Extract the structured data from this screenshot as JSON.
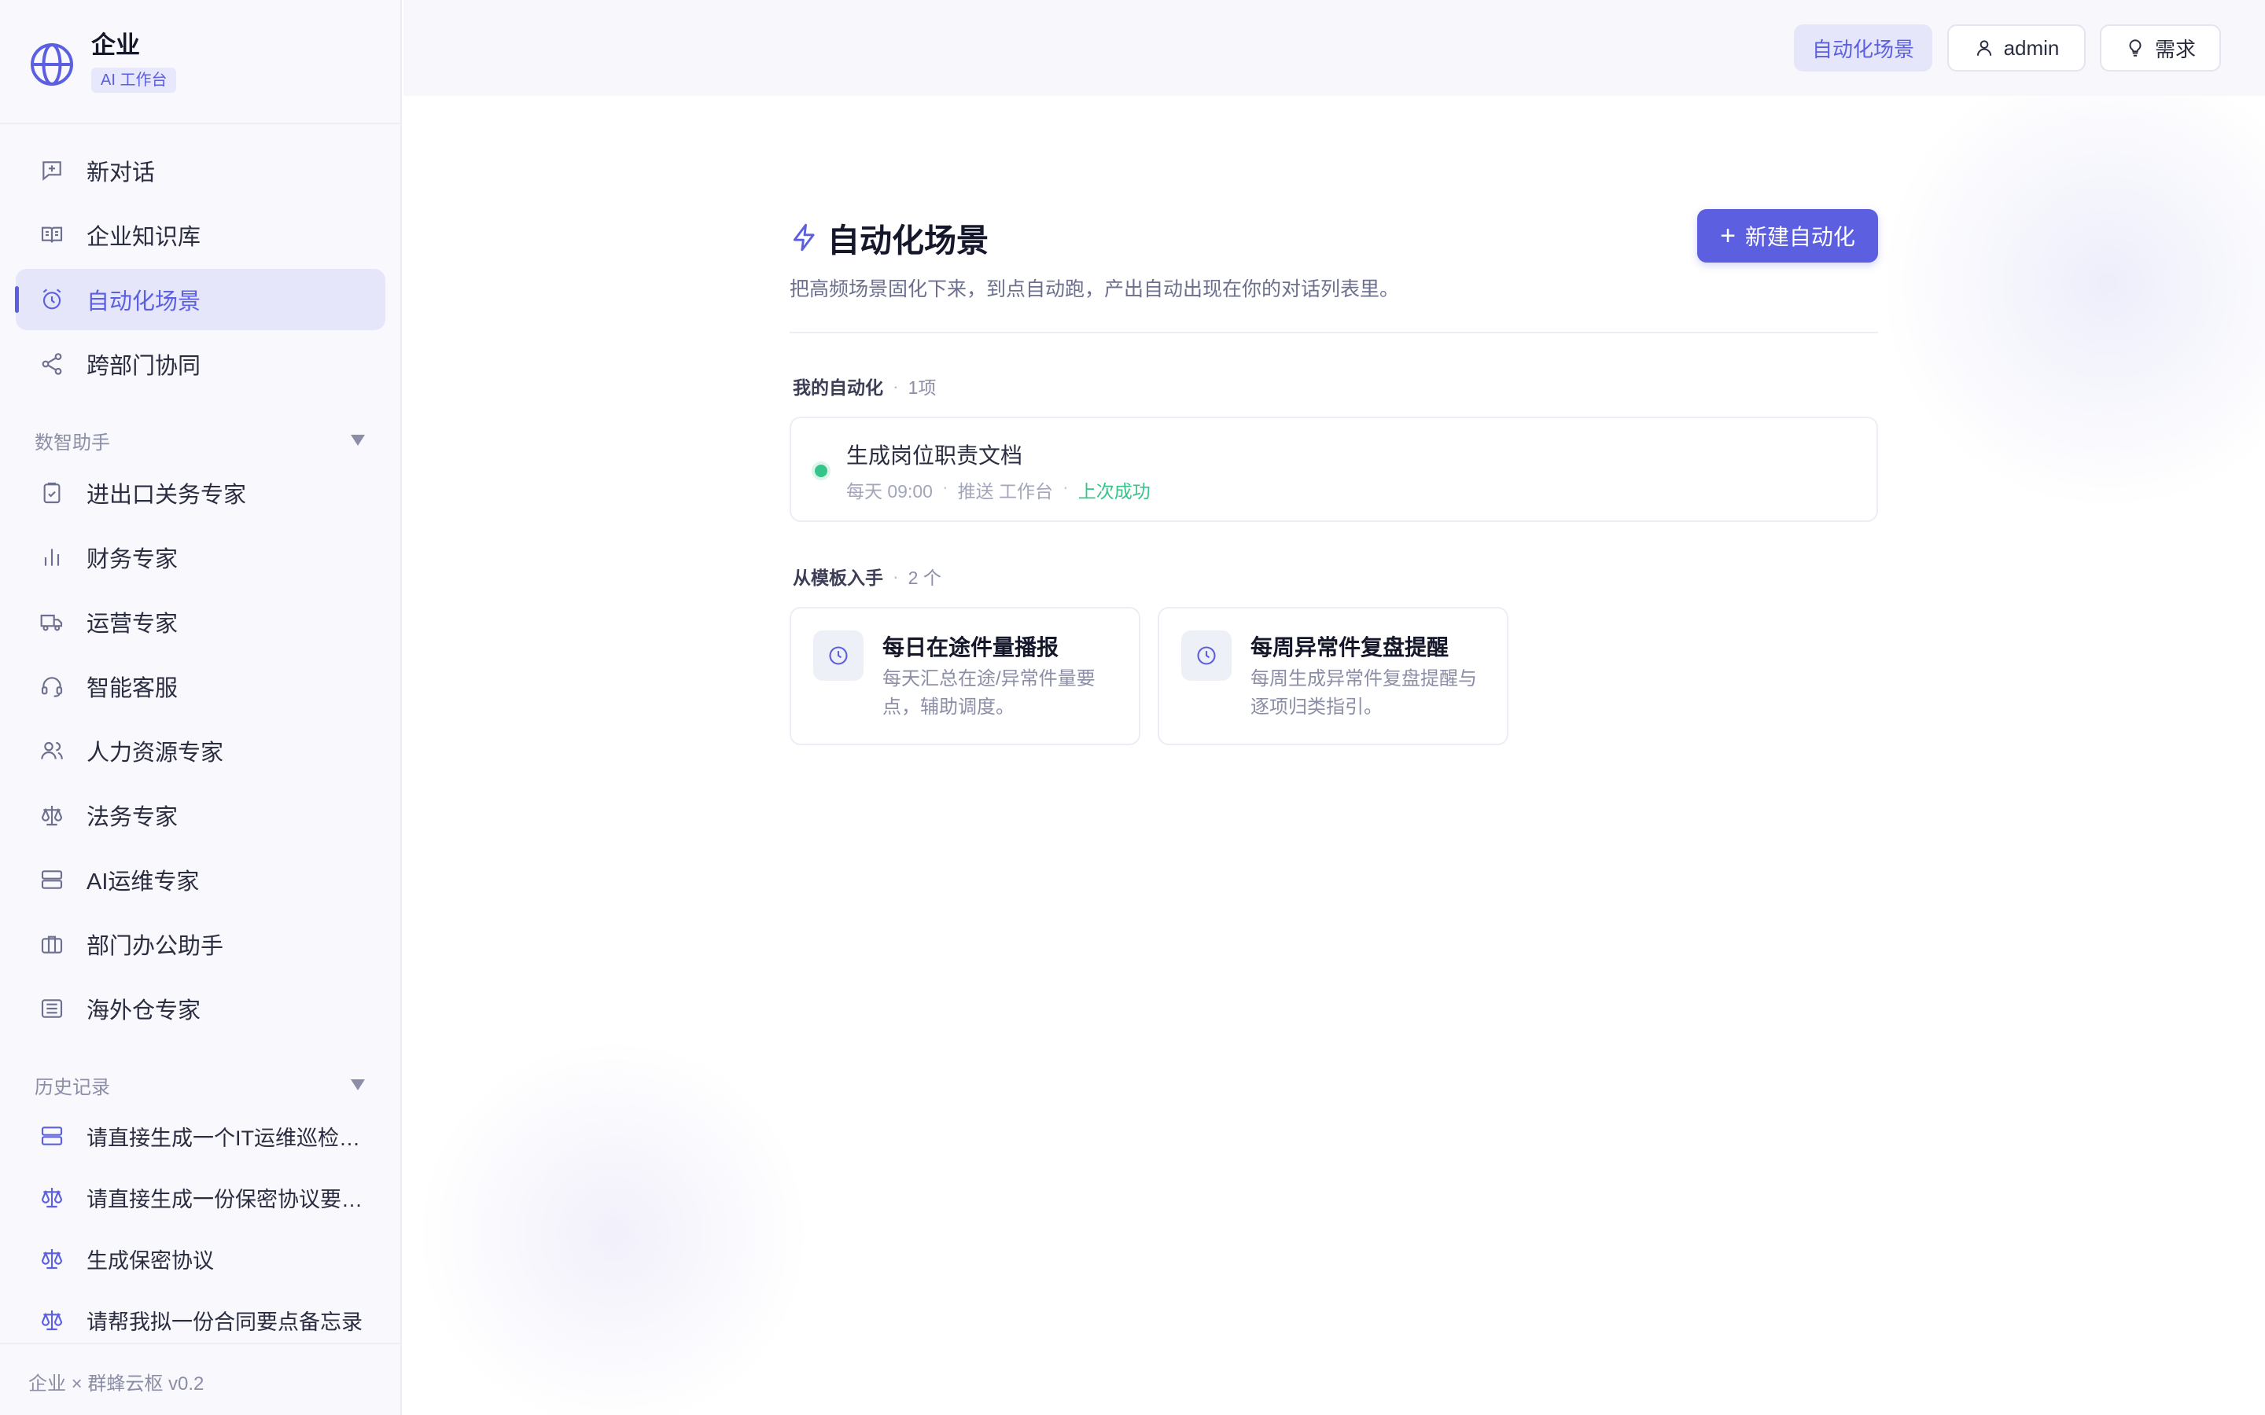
{
  "brand": {
    "name": "企业",
    "badge": "AI 工作台",
    "logo_icon": "globe-icon"
  },
  "nav": {
    "items": [
      {
        "label": "新对话",
        "icon": "chat-plus-icon",
        "active": false
      },
      {
        "label": "企业知识库",
        "icon": "book-icon",
        "active": false
      },
      {
        "label": "自动化场景",
        "icon": "alarm-clock-icon",
        "active": true
      },
      {
        "label": "跨部门协同",
        "icon": "share-icon",
        "active": false
      }
    ]
  },
  "assistants": {
    "title": "数智助手",
    "items": [
      {
        "label": "进出口关务专家",
        "icon": "clipboard-check-icon"
      },
      {
        "label": "财务专家",
        "icon": "bar-chart-icon"
      },
      {
        "label": "运营专家",
        "icon": "truck-icon"
      },
      {
        "label": "智能客服",
        "icon": "headset-icon"
      },
      {
        "label": "人力资源专家",
        "icon": "users-icon"
      },
      {
        "label": "法务专家",
        "icon": "scale-icon"
      },
      {
        "label": "AI运维专家",
        "icon": "server-icon"
      },
      {
        "label": "部门办公助手",
        "icon": "briefcase-icon"
      },
      {
        "label": "海外仓专家",
        "icon": "warehouse-icon"
      }
    ]
  },
  "history": {
    "title": "历史记录",
    "items": [
      {
        "label": "请直接生成一个IT运维巡检清单",
        "icon": "server-icon"
      },
      {
        "label": "请直接生成一份保密协议要点清单",
        "icon": "scale-icon"
      },
      {
        "label": "生成保密协议",
        "icon": "scale-icon"
      },
      {
        "label": "请帮我拟一份合同要点备忘录",
        "icon": "scale-icon"
      }
    ]
  },
  "footer": {
    "text": "企业 × 群蜂云枢 v0.2"
  },
  "topbar": {
    "scene_label": "自动化场景",
    "user_label": "admin",
    "request_label": "需求"
  },
  "page": {
    "title": "自动化场景",
    "description": "把高频场景固化下来，到点自动跑，产出自动出现在你的对话列表里。",
    "new_button": "新建自动化"
  },
  "my_automations": {
    "title": "我的自动化",
    "count": "1项",
    "items": [
      {
        "name": "生成岗位职责文档",
        "schedule": "每天 09:00",
        "push": "推送 工作台",
        "status": "上次成功",
        "status_color": "#35c48a"
      }
    ]
  },
  "templates": {
    "title": "从模板入手",
    "count": "2 个",
    "items": [
      {
        "title": "每日在途件量播报",
        "desc": "每天汇总在途/异常件量要点，辅助调度。",
        "icon": "clock-icon"
      },
      {
        "title": "每周异常件复盘提醒",
        "desc": "每周生成异常件复盘提醒与逐项归类指引。",
        "icon": "clock-icon"
      }
    ]
  },
  "colors": {
    "accent": "#5b5fe0",
    "success": "#35c48a",
    "sidebar_bg": "#f8f8fd"
  }
}
